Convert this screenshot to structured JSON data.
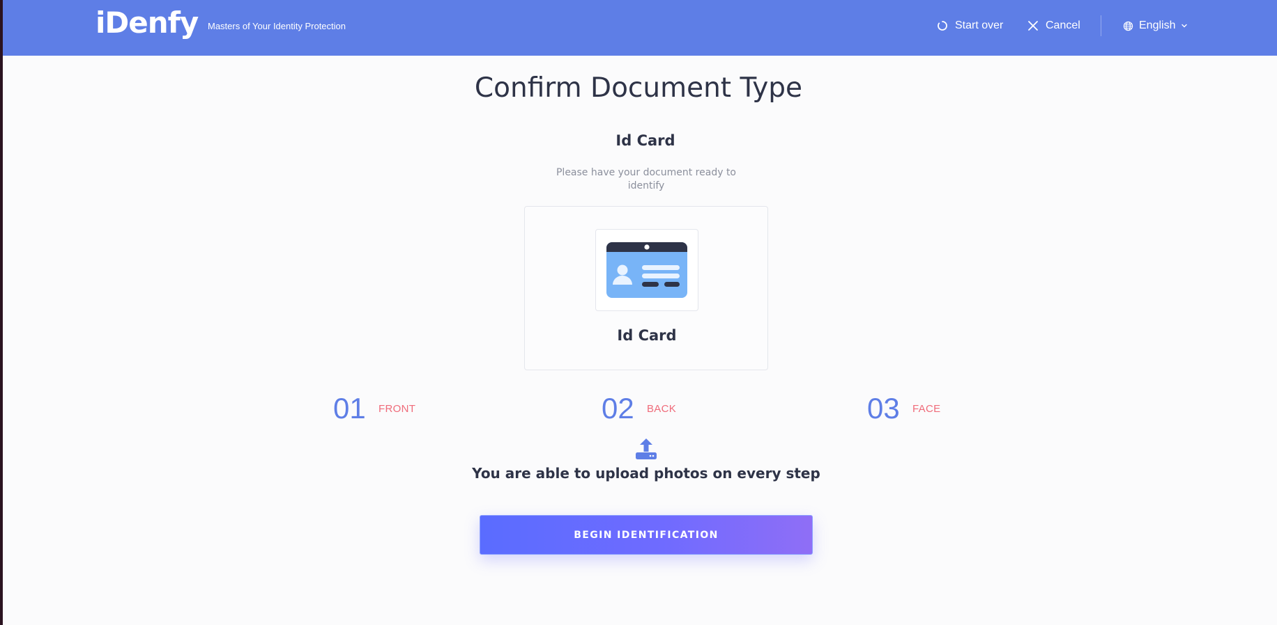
{
  "header": {
    "logo_text": "iDenfy",
    "tagline": "Masters of Your Identity Protection",
    "start_over_label": "Start over",
    "cancel_label": "Cancel",
    "language_label": "English",
    "background_color": "#5e7ee6"
  },
  "main": {
    "title": "Confirm Document Type",
    "document_type": "Id Card",
    "hint": "Please have your document ready to identify",
    "card": {
      "label": "Id Card",
      "icon": "id-card-icon"
    },
    "steps": [
      {
        "number": "01",
        "label": "FRONT"
      },
      {
        "number": "02",
        "label": "BACK"
      },
      {
        "number": "03",
        "label": "FACE"
      }
    ],
    "upload_notice": "You are able to upload photos on every step",
    "begin_button_label": "BEGIN IDENTIFICATION"
  },
  "colors": {
    "accent": "#5e7ee6",
    "step_label": "#ef6b7a",
    "text_dark": "#2e3347",
    "text_muted": "#8b8f9c"
  }
}
